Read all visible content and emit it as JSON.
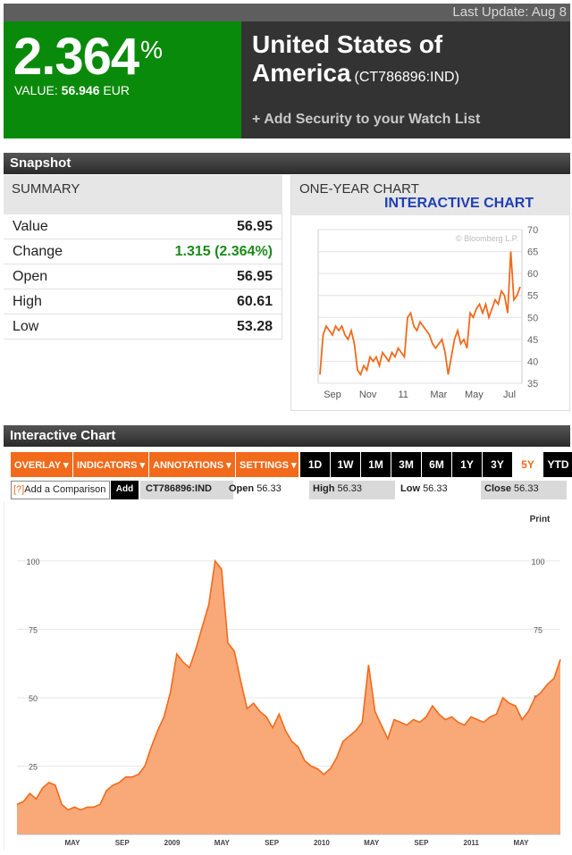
{
  "header": {
    "last_update": "Last Update: Aug 8",
    "pct_value": "2.364",
    "pct_sign": "%",
    "value_label": "VALUE:",
    "value_number": "56.946",
    "value_currency": "EUR",
    "name": "United States of America",
    "ticker": "(CT786896:IND)",
    "watch_link": "+ Add Security to your Watch List"
  },
  "snapshot": {
    "title": "Snapshot",
    "summary_title": "SUMMARY",
    "rows": [
      {
        "label": "Value",
        "value": "56.95"
      },
      {
        "label": "Change",
        "value": "1.315 (2.364%)"
      },
      {
        "label": "Open",
        "value": "56.95"
      },
      {
        "label": "High",
        "value": "60.61"
      },
      {
        "label": "Low",
        "value": "53.28"
      }
    ],
    "one_year_title": "ONE-YEAR CHART",
    "interactive_link": "INTERACTIVE CHART",
    "watermark": "© Bloomberg L.P."
  },
  "interactive": {
    "title": "Interactive Chart",
    "menus": [
      "OVERLAY ▾",
      "INDICATORS ▾",
      "ANNOTATIONS ▾",
      "SETTINGS ▾"
    ],
    "ranges": [
      "1D",
      "1W",
      "1M",
      "3M",
      "6M",
      "1Y",
      "3Y",
      "5Y",
      "YTD"
    ],
    "selected_range": "5Y",
    "compare_q": "[?]",
    "compare_label": "Add a Comparison",
    "add_label": "Add",
    "ticker": "CT786896:IND",
    "open_label": "Open",
    "open_value": "56.33",
    "high_label": "High",
    "high_value": "56.33",
    "low_label": "Low",
    "low_value": "56.33",
    "close_label": "Close",
    "close_value": "56.33",
    "print_label": "Print"
  },
  "chart_data": [
    {
      "type": "line",
      "title": "ONE-YEAR CHART",
      "x_ticks": [
        "Sep",
        "Nov",
        "11",
        "Mar",
        "May",
        "Jul"
      ],
      "ylim": [
        35,
        70
      ],
      "y_ticks": [
        35,
        40,
        45,
        50,
        55,
        60,
        65,
        70
      ],
      "y_axis_side": "right",
      "grid": true,
      "color": "#f26a1b",
      "values": [
        37,
        46,
        48,
        47,
        46,
        48,
        47,
        48,
        46,
        45,
        47,
        44,
        38,
        37,
        39,
        38,
        41,
        40,
        41,
        39,
        42,
        41,
        40,
        42,
        41,
        43,
        42,
        41,
        50,
        51,
        48,
        47,
        49,
        48,
        47,
        46,
        44,
        43,
        44,
        45,
        42,
        37,
        41,
        45,
        47,
        44,
        45,
        43,
        51,
        50,
        52,
        53,
        51,
        53,
        50,
        52,
        54,
        53,
        56,
        55,
        51,
        65,
        54,
        55,
        57
      ]
    },
    {
      "type": "area",
      "title": "Interactive Chart",
      "x_ticks": [
        "MAY",
        "SEP",
        "2009",
        "MAY",
        "SEP",
        "2010",
        "MAY",
        "SEP",
        "2011",
        "MAY"
      ],
      "ylim": [
        0,
        115
      ],
      "y_ticks": [
        25,
        50,
        75,
        100
      ],
      "y_axis_side": "both",
      "grid": true,
      "color": "#f26a1b",
      "fill": "#f9a878",
      "values": [
        11,
        12,
        15,
        13,
        17,
        19,
        18,
        11,
        9,
        10,
        9,
        10,
        10,
        11,
        16,
        18,
        19,
        21,
        21,
        22,
        25,
        32,
        38,
        43,
        52,
        66,
        63,
        61,
        68,
        76,
        84,
        100,
        97,
        70,
        67,
        56,
        46,
        48,
        45,
        43,
        39,
        44,
        38,
        34,
        32,
        27,
        25,
        24,
        22,
        24,
        28,
        34,
        36,
        38,
        41,
        62,
        45,
        40,
        35,
        42,
        41,
        40,
        42,
        41,
        43,
        47,
        44,
        42,
        43,
        41,
        40,
        43,
        42,
        41,
        43,
        44,
        50,
        48,
        47,
        42,
        45,
        50,
        52,
        55,
        57,
        64
      ]
    }
  ]
}
